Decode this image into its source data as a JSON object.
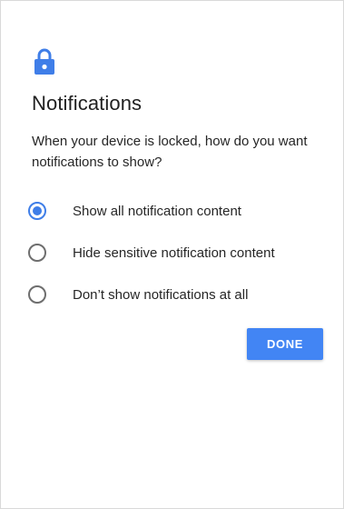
{
  "dialog": {
    "title": "Notifications",
    "description": "When your device is locked, how do you want notifications to show?",
    "lock_icon": "lock-icon",
    "options": [
      {
        "label": "Show all notification content",
        "selected": true
      },
      {
        "label": "Hide sensitive notification content",
        "selected": false
      },
      {
        "label": "Don’t show notifications at all",
        "selected": false
      }
    ],
    "done_label": "DONE"
  },
  "colors": {
    "accent": "#4285f4",
    "radio_selected": "#3f7ee8",
    "radio_unselected": "#6e6e6e",
    "text": "#262626"
  }
}
